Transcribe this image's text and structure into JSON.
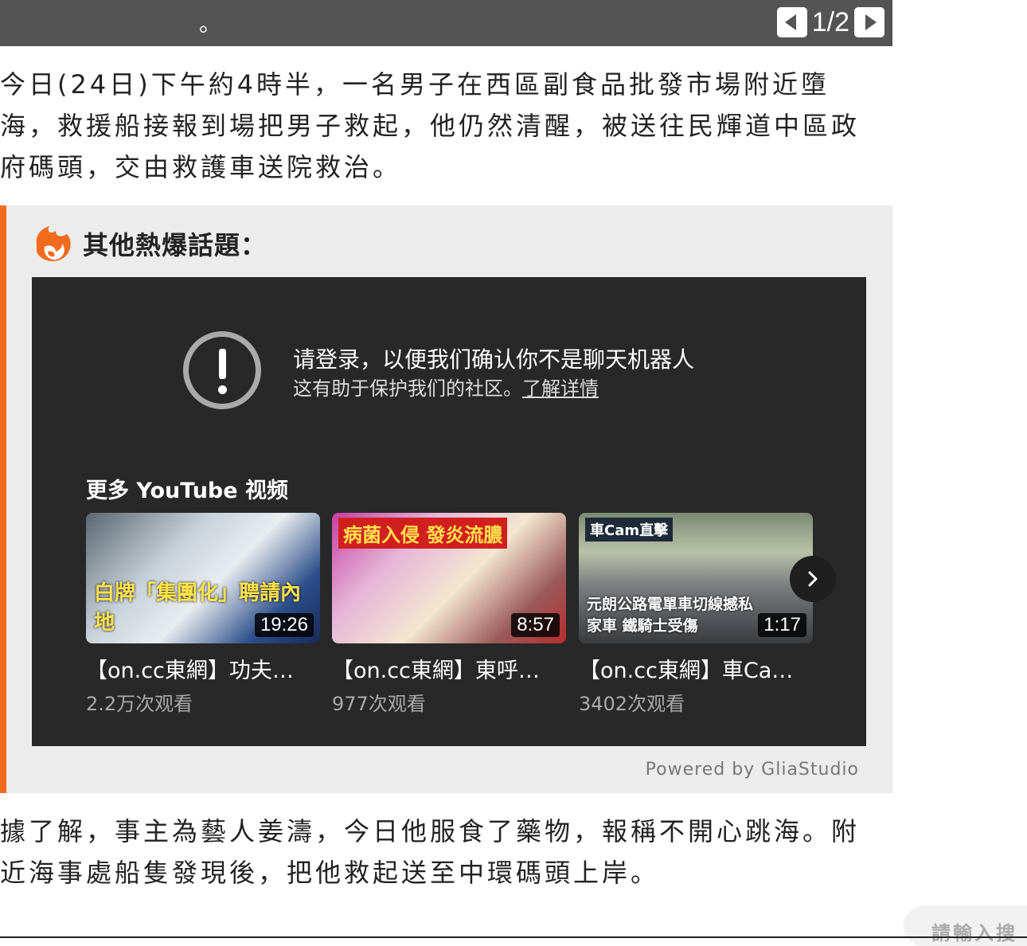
{
  "caption": {
    "text": "。",
    "pager": "1/2"
  },
  "article": {
    "paragraph1": [
      "今日(24日)下午約4時半，一名男子在西區副食品批發市場附近墮",
      "海，救援船接報到場把男子救起，他仍然清醒，被送往民輝道中區政",
      "府碼頭，交由救護車送院救治。"
    ],
    "paragraph2": [
      "據了解，事主為藝人姜濤，今日他服食了藥物，報稱不開心跳海。附",
      "近海事處船隻發現後，把他救起送至中環碼頭上岸。"
    ]
  },
  "hot_topics": {
    "title": "其他熱爆話題：",
    "accent": "#f26b1d",
    "youtube": {
      "login_title": "请登录，以便我们确认你不是聊天机器人",
      "login_sub": "这有助于保护我们的社区。",
      "learn_more": "了解详情",
      "more_videos_title": "更多 YouTube 视频",
      "videos": [
        {
          "title": "【on.cc東網】功夫…",
          "views": "2.2万次观看",
          "duration": "19:26",
          "overlay": "白牌「集團化」聘請內地",
          "tag": ""
        },
        {
          "title": "【on.cc東網】東呼…",
          "views": "977次观看",
          "duration": "8:57",
          "overlay": "",
          "tag": "病菌入侵 發炎流膿"
        },
        {
          "title": "【on.cc東網】車Ca…",
          "views": "3402次观看",
          "duration": "1:17",
          "overlay": "元朗公路電單車切線撼私家車 鐵騎士受傷",
          "tag": "車Cam直擊"
        }
      ]
    },
    "powered_by": "Powered by GliaStudio"
  },
  "search": {
    "placeholder": "請輸入搜"
  }
}
